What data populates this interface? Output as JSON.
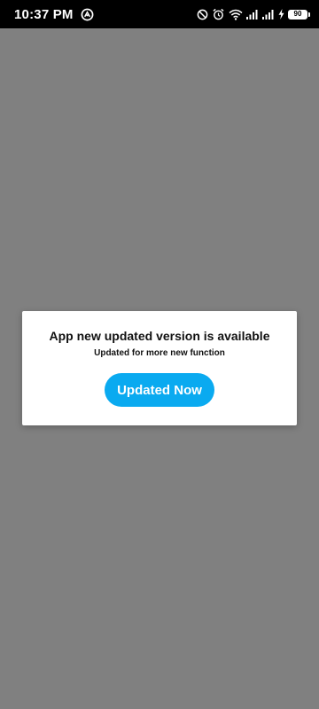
{
  "status_bar": {
    "time": "10:37 PM",
    "battery_level": "90",
    "icons": [
      "app-notification-icon",
      "do-not-disturb-icon",
      "alarm-icon",
      "wifi-icon",
      "cellular-signal-icon",
      "cellular-signal-icon",
      "charging-icon",
      "battery-icon"
    ]
  },
  "dialog": {
    "title": "App new updated version is available",
    "subtitle": "Updated for more new function",
    "button_label": "Updated Now"
  },
  "colors": {
    "overlay": "#808080",
    "status_bar_bg": "#000000",
    "dialog_bg": "#ffffff",
    "button_bg": "#0aaaf0",
    "button_text": "#ffffff"
  }
}
